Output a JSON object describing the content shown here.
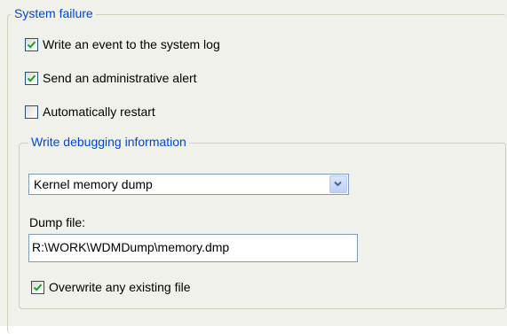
{
  "system_failure": {
    "legend": "System failure",
    "write_event": {
      "label": "Write an event to the system log",
      "checked": true
    },
    "send_alert": {
      "label": "Send an administrative alert",
      "checked": true
    },
    "auto_restart": {
      "label": "Automatically restart",
      "checked": false
    }
  },
  "debugging": {
    "legend": "Write debugging information",
    "dump_type": {
      "value": "Kernel memory dump"
    },
    "dump_file": {
      "label": "Dump file:",
      "value": "R:\\WORK\\WDMDump\\memory.dmp"
    },
    "overwrite": {
      "label": "Overwrite any existing file",
      "checked": true
    }
  },
  "colors": {
    "panel_bg": "#f1f1eb",
    "legend_text": "#0046d5",
    "checkmark": "#21a121",
    "frame_border": "#d0d0bf",
    "field_border": "#7f9db9"
  }
}
